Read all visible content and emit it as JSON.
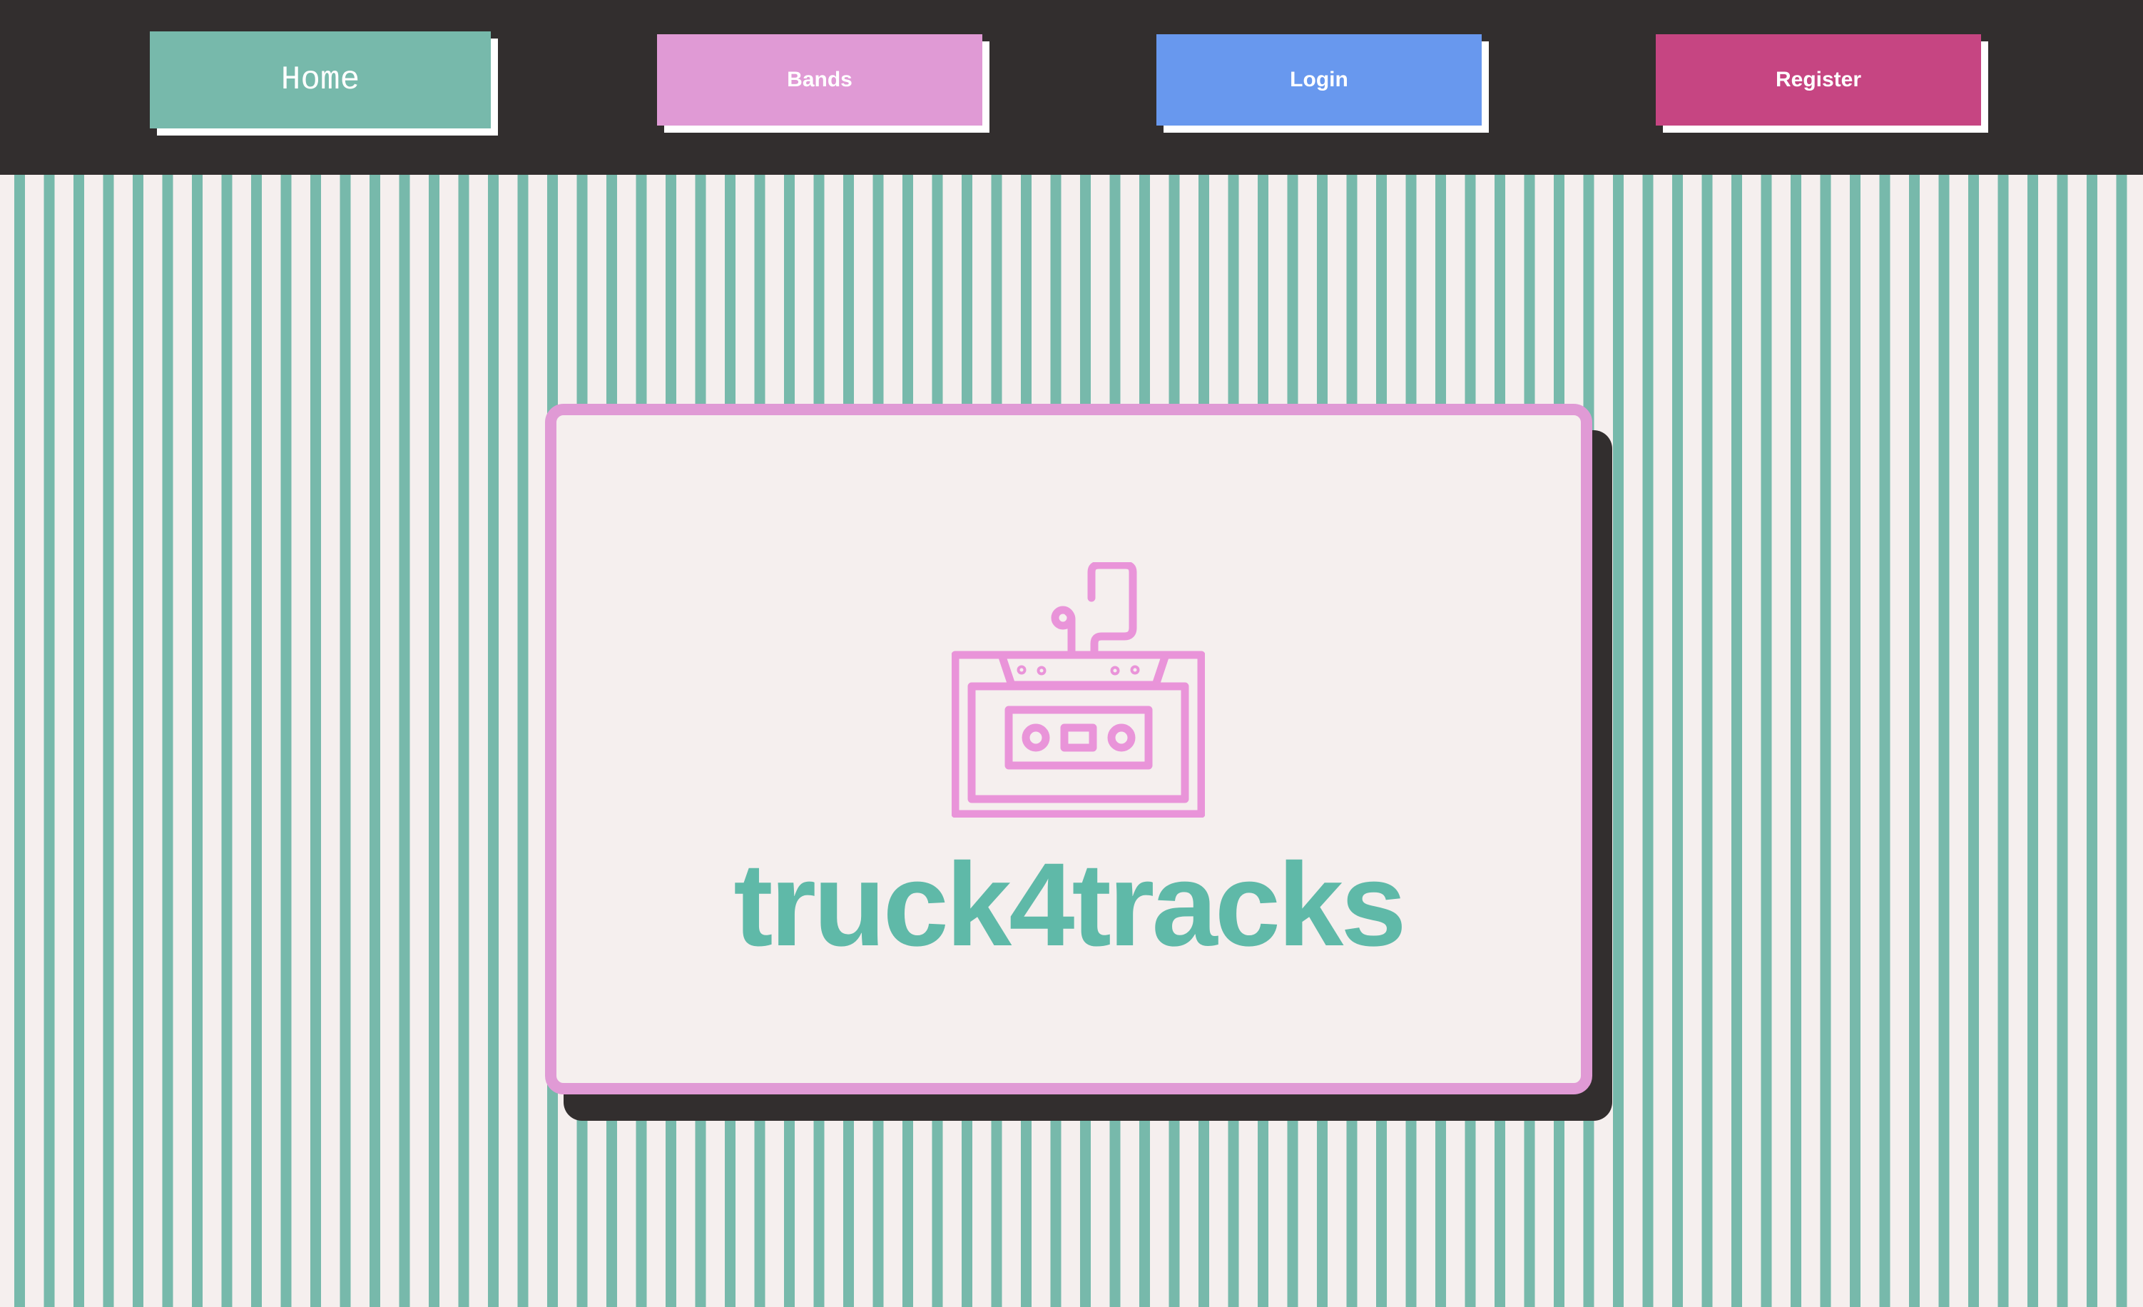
{
  "nav": {
    "items": [
      {
        "label": "Home",
        "color": "#77b9ab"
      },
      {
        "label": "Bands",
        "color": "#e09ad5"
      },
      {
        "label": "Login",
        "color": "#6898ee"
      },
      {
        "label": "Register",
        "color": "#c64582"
      }
    ]
  },
  "hero": {
    "icon": "cassette-tape-icon",
    "brand_name": "truck4tracks",
    "brand_color": "#5fb9a8",
    "icon_color": "#e994d9",
    "border_color": "#e09ad5"
  },
  "colors": {
    "topbar": "#322e2e",
    "stripe": "#77b9ab",
    "background": "#f5efee",
    "card_shadow": "#322e2e"
  }
}
